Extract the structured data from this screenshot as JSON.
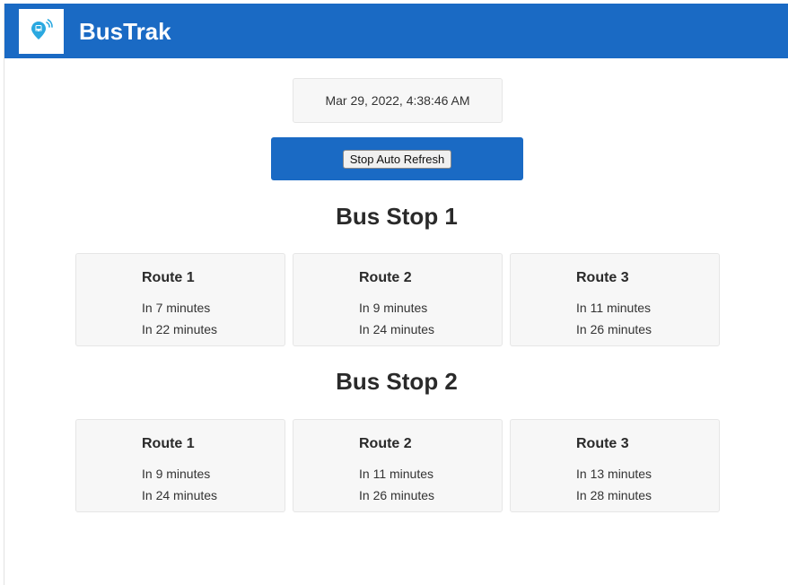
{
  "app": {
    "title": "BusTrak",
    "logo_icon": "bus-location-pin-icon"
  },
  "clock": {
    "datetime": "Mar 29, 2022, 4:38:46 AM"
  },
  "refresh": {
    "button_label": "Stop Auto Refresh"
  },
  "stops": [
    {
      "title": "Bus Stop 1",
      "routes": [
        {
          "name": "Route 1",
          "arrivals": [
            "In 7 minutes",
            "In 22 minutes"
          ]
        },
        {
          "name": "Route 2",
          "arrivals": [
            "In 9 minutes",
            "In 24 minutes"
          ]
        },
        {
          "name": "Route 3",
          "arrivals": [
            "In 11 minutes",
            "In 26 minutes"
          ]
        }
      ]
    },
    {
      "title": "Bus Stop 2",
      "routes": [
        {
          "name": "Route 1",
          "arrivals": [
            "In 9 minutes",
            "In 24 minutes"
          ]
        },
        {
          "name": "Route 2",
          "arrivals": [
            "In 11 minutes",
            "In 26 minutes"
          ]
        },
        {
          "name": "Route 3",
          "arrivals": [
            "In 13 minutes",
            "In 28 minutes"
          ]
        }
      ]
    }
  ],
  "colors": {
    "brand": "#1a6ac4",
    "card_bg": "#f7f7f7",
    "logo_accent": "#2aa8e0"
  }
}
